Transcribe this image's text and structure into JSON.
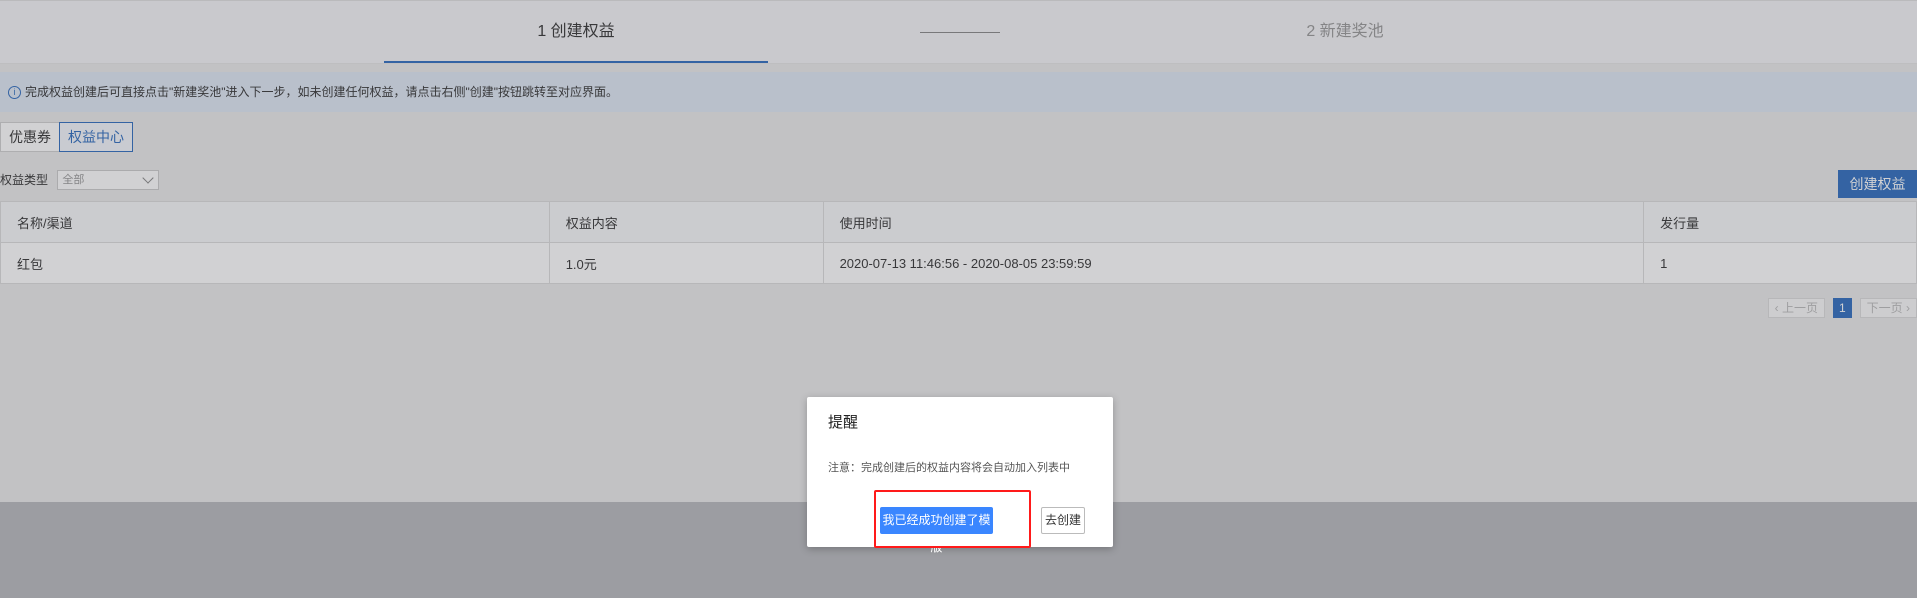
{
  "steps": {
    "step1": "1 创建权益",
    "step2": "2 新建奖池"
  },
  "tip": {
    "icon": "info-icon",
    "text": "完成权益创建后可直接点击\"新建奖池\"进入下一步，如未创建任何权益，请点击右侧\"创建\"按钮跳转至对应界面。"
  },
  "tabs": [
    "优惠券",
    "权益中心"
  ],
  "filter": {
    "label": "权益类型",
    "value": "全部"
  },
  "toolbar": {
    "create_label": "创建权益"
  },
  "table": {
    "headers": [
      "名称/渠道",
      "权益内容",
      "使用时间",
      "发行量"
    ],
    "rows": [
      {
        "name": "红包",
        "content": "1.0元",
        "time": "2020-07-13 11:46:56 - 2020-08-05 23:59:59",
        "qty": "1"
      }
    ]
  },
  "pager": {
    "prev": "上一页",
    "current": "1",
    "next": "下一页"
  },
  "dialog": {
    "title": "提醒",
    "message": "注意：完成创建后的权益内容将会自动加入列表中",
    "confirm": "我已经成功创建了模版",
    "go_create": "去创建"
  },
  "colors": {
    "accent": "#2e6dbf",
    "primary_button": "#3a86ff",
    "highlight": "#ff1a1a"
  }
}
